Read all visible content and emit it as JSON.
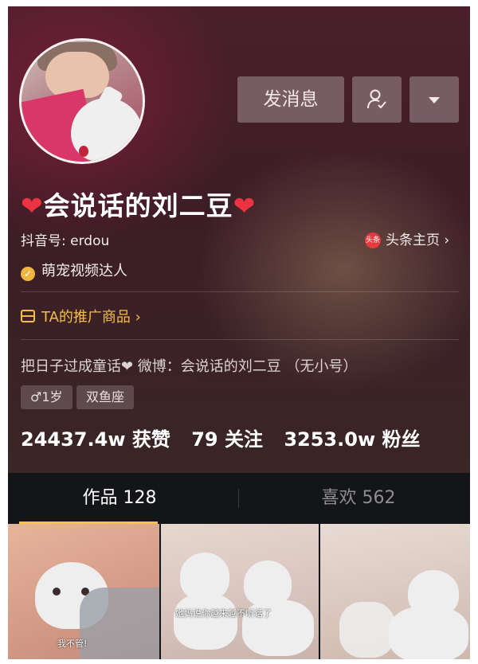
{
  "header": {
    "message_button": "发消息",
    "follow_icon": "person-check-icon",
    "more_icon": "dropdown-triangle-icon"
  },
  "profile": {
    "name": "会说话的刘二豆",
    "heart": "❤",
    "douyin_id": "抖音号: erdou",
    "toutiao_badge": "头条",
    "toutiao_link": "头条主页 ›",
    "verified_label": "萌宠视频达人",
    "shop_link": "TA的推广商品 ›",
    "bio": "把日子过成童话❤ 微博：会说话的刘二豆 （无小号）",
    "tags": [
      "♂1岁",
      "双鱼座"
    ],
    "stats": {
      "likes": "24437.4w 获赞",
      "following": "79 关注",
      "followers": "3253.0w 粉丝"
    }
  },
  "tabs": {
    "works": "作品 128",
    "likes": "喜欢 562",
    "active_color": "#f7c53d"
  },
  "thumbnails": {
    "captions": [
      "我不管!",
      "她妈说你越来越不听话了"
    ]
  }
}
